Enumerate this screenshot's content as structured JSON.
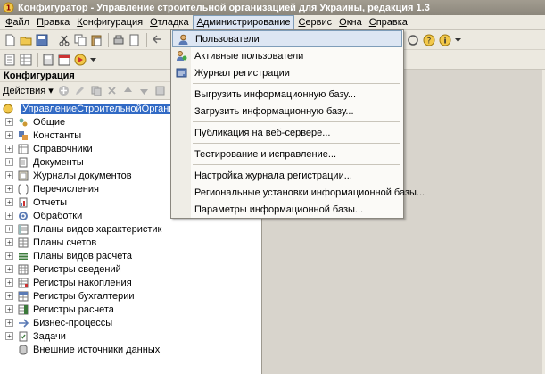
{
  "window": {
    "title": "Конфигуратор - Управление строительной организацией для Украины, редакция 1.3"
  },
  "menubar": {
    "items": [
      {
        "label": "Файл",
        "key": "Ф",
        "rest": "айл"
      },
      {
        "label": "Правка",
        "key": "П",
        "rest": "равка"
      },
      {
        "label": "Конфигурация",
        "key": "К",
        "rest": "онфигурация"
      },
      {
        "label": "Отладка",
        "key": "О",
        "rest": "тладка"
      },
      {
        "label": "Администрирование",
        "key": "А",
        "rest": "дминистрирование"
      },
      {
        "label": "Сервис",
        "key": "С",
        "rest": "ервис"
      },
      {
        "label": "Окна",
        "key": "О",
        "rest": "кна"
      },
      {
        "label": "Справка",
        "key": "С",
        "rest": "правка"
      }
    ]
  },
  "panel": {
    "title": "Конфигурация",
    "actions_key": "Д",
    "actions_rest": "ействия",
    "root_label": "УправлениеСтроительнойОрганизациейД",
    "items": [
      {
        "label": "Общие",
        "icon": "common-icon"
      },
      {
        "label": "Константы",
        "icon": "constants-icon"
      },
      {
        "label": "Справочники",
        "icon": "catalogs-icon"
      },
      {
        "label": "Документы",
        "icon": "documents-icon"
      },
      {
        "label": "Журналы документов",
        "icon": "journals-icon"
      },
      {
        "label": "Перечисления",
        "icon": "enums-icon"
      },
      {
        "label": "Отчеты",
        "icon": "reports-icon"
      },
      {
        "label": "Обработки",
        "icon": "processing-icon"
      },
      {
        "label": "Планы видов характеристик",
        "icon": "chart-of-characteristics-icon"
      },
      {
        "label": "Планы счетов",
        "icon": "chart-of-accounts-icon"
      },
      {
        "label": "Планы видов расчета",
        "icon": "chart-of-calculation-icon"
      },
      {
        "label": "Регистры сведений",
        "icon": "info-registers-icon"
      },
      {
        "label": "Регистры накопления",
        "icon": "accumulation-registers-icon"
      },
      {
        "label": "Регистры бухгалтерии",
        "icon": "accounting-registers-icon"
      },
      {
        "label": "Регистры расчета",
        "icon": "calculation-registers-icon"
      },
      {
        "label": "Бизнес-процессы",
        "icon": "business-processes-icon"
      },
      {
        "label": "Задачи",
        "icon": "tasks-icon"
      },
      {
        "label": "Внешние источники данных",
        "icon": "external-sources-icon"
      }
    ]
  },
  "admin_menu": {
    "items": [
      {
        "label": "Пользователи",
        "icon": "user-icon"
      },
      {
        "label": "Активные пользователи",
        "icon": "active-users-icon"
      },
      {
        "label": "Журнал регистрации",
        "icon": "log-icon"
      },
      {
        "label": "Выгрузить информационную базу..."
      },
      {
        "label": "Загрузить информационную базу..."
      },
      {
        "label": "Публикация на веб-сервере..."
      },
      {
        "label": "Тестирование и исправление..."
      },
      {
        "label": "Настройка журнала регистрации..."
      },
      {
        "label": "Региональные установки информационной базы..."
      },
      {
        "label": "Параметры информационной базы..."
      }
    ]
  },
  "colors": {
    "selection": "#316ac5",
    "menu_highlight": "#dde6f3",
    "title_bar": "#9a9488"
  }
}
